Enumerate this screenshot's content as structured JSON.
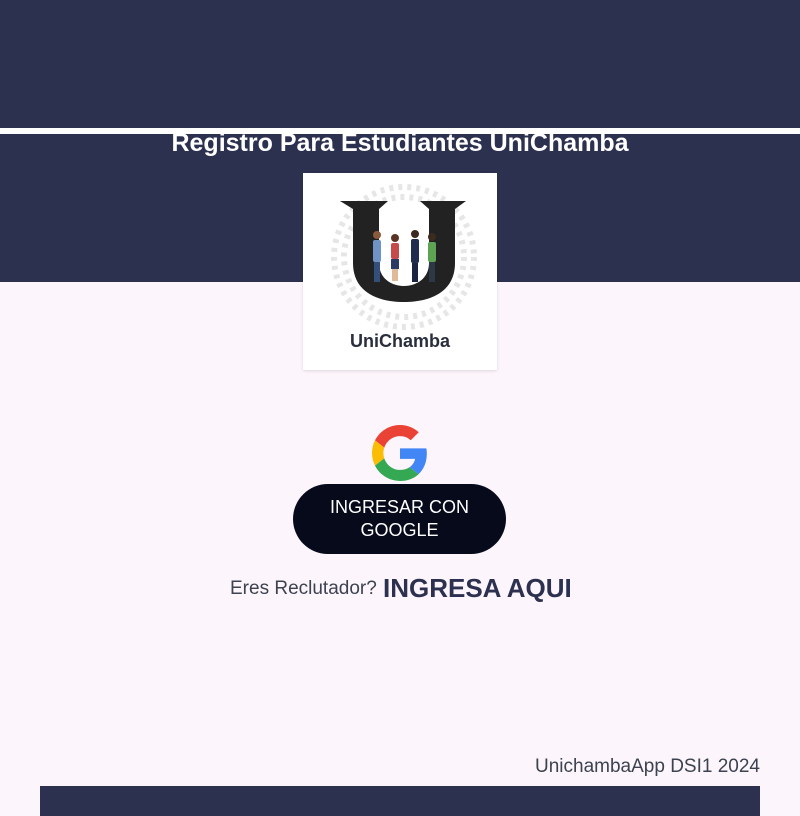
{
  "header": {
    "title": "Registro Para Estudiantes UniChamba"
  },
  "logo": {
    "text": "UniChamba",
    "icon": "unichamba-logo"
  },
  "login": {
    "google_icon": "google-icon",
    "google_button_label": "INGRESAR CON GOOGLE"
  },
  "recruiter": {
    "question": "Eres Reclutador?",
    "link_label": "INGRESA AQUI"
  },
  "footer": {
    "text": "UnichambaApp DSI1 2024"
  },
  "colors": {
    "primary": "#2d3150",
    "button": "#060a1b",
    "background": "#fcf6fc"
  }
}
